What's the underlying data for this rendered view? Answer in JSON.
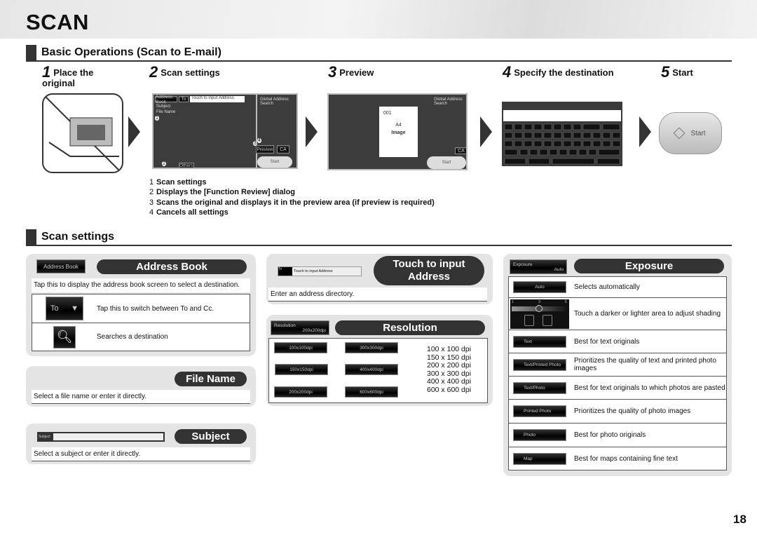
{
  "page_title": "SCAN",
  "basic": {
    "heading": "Basic Operations (Scan to E-mail)",
    "steps": [
      {
        "num": "1",
        "label": "Place the original"
      },
      {
        "num": "2",
        "label": "Scan settings"
      },
      {
        "num": "3",
        "label": "Preview"
      },
      {
        "num": "4",
        "label": "Specify the destination"
      },
      {
        "num": "5",
        "label": "Start"
      }
    ],
    "scan_screen": {
      "address_book": "Address Book",
      "to": "To",
      "address_placeholder": "Touch to input Address",
      "subject": "Subject",
      "file_name": "File Name",
      "others": "Others",
      "preview": "Preview",
      "ca": "CA",
      "start": "Start",
      "global_search": "Global Address Search",
      "callouts": [
        "1",
        "2",
        "3",
        "4"
      ]
    },
    "preview_screen": {
      "page_no": "001",
      "size": "A4",
      "image": "Image",
      "ca": "CA",
      "start": "Start"
    },
    "start_button": "Start",
    "legend": [
      {
        "k": "1",
        "v": "Scan settings"
      },
      {
        "k": "2",
        "v": "Displays the [Function Review] dialog"
      },
      {
        "k": "3",
        "v": "Scans the original and displays it in the preview area (if preview is required)"
      },
      {
        "k": "4",
        "v": "Cancels all settings"
      }
    ]
  },
  "settings": {
    "heading": "Scan settings",
    "address_book": {
      "button": "Address Book",
      "title": "Address Book",
      "desc": "Tap this to display the address book screen to select a destination.",
      "rows": [
        {
          "icon": "To",
          "text": "Tap this to switch between To and Cc."
        },
        {
          "icon": "search-icon",
          "text": "Searches a destination"
        }
      ]
    },
    "file_name": {
      "title": "File Name",
      "desc": "Select a file name or enter it directly."
    },
    "subject": {
      "button": "Subject",
      "title": "Subject",
      "desc": "Select a subject or enter it directly."
    },
    "touch_input": {
      "to": "To",
      "field": "Touch to input Address",
      "title": "Touch to input Address",
      "desc": "Enter an address directory."
    },
    "resolution": {
      "button": "Resolution",
      "button_value": "200x200dpi",
      "title": "Resolution",
      "buttons": [
        "100x100dpi",
        "300x300dpi",
        "150x150dpi",
        "400x400dpi",
        "200x200dpi",
        "600x600dpi"
      ],
      "values": [
        "100 x 100 dpi",
        "150 x 150 dpi",
        "200 x 200 dpi",
        "300 x 300 dpi",
        "400 x 400 dpi",
        "600 x 600 dpi"
      ]
    },
    "exposure": {
      "button": "Exposure",
      "button_value": "Auto",
      "title": "Exposure",
      "scale": [
        "1",
        "3",
        "5"
      ],
      "rows": [
        {
          "button": "Auto",
          "text": "Selects automatically"
        },
        {
          "button": "",
          "text": "Touch a darker or lighter area to adjust shading"
        },
        {
          "button": "Text",
          "text": "Best for text originals"
        },
        {
          "button": "Text/Printed Photo",
          "text": "Prioritizes the quality of text and printed photo images"
        },
        {
          "button": "Text/Photo",
          "text": "Best for text originals to which photos are pasted"
        },
        {
          "button": "Printed Photo",
          "text": "Prioritizes the quality of photo images"
        },
        {
          "button": "Photo",
          "text": "Best for photo originals"
        },
        {
          "button": "Map",
          "text": "Best for maps containing fine text"
        }
      ]
    }
  },
  "page_number": "18"
}
